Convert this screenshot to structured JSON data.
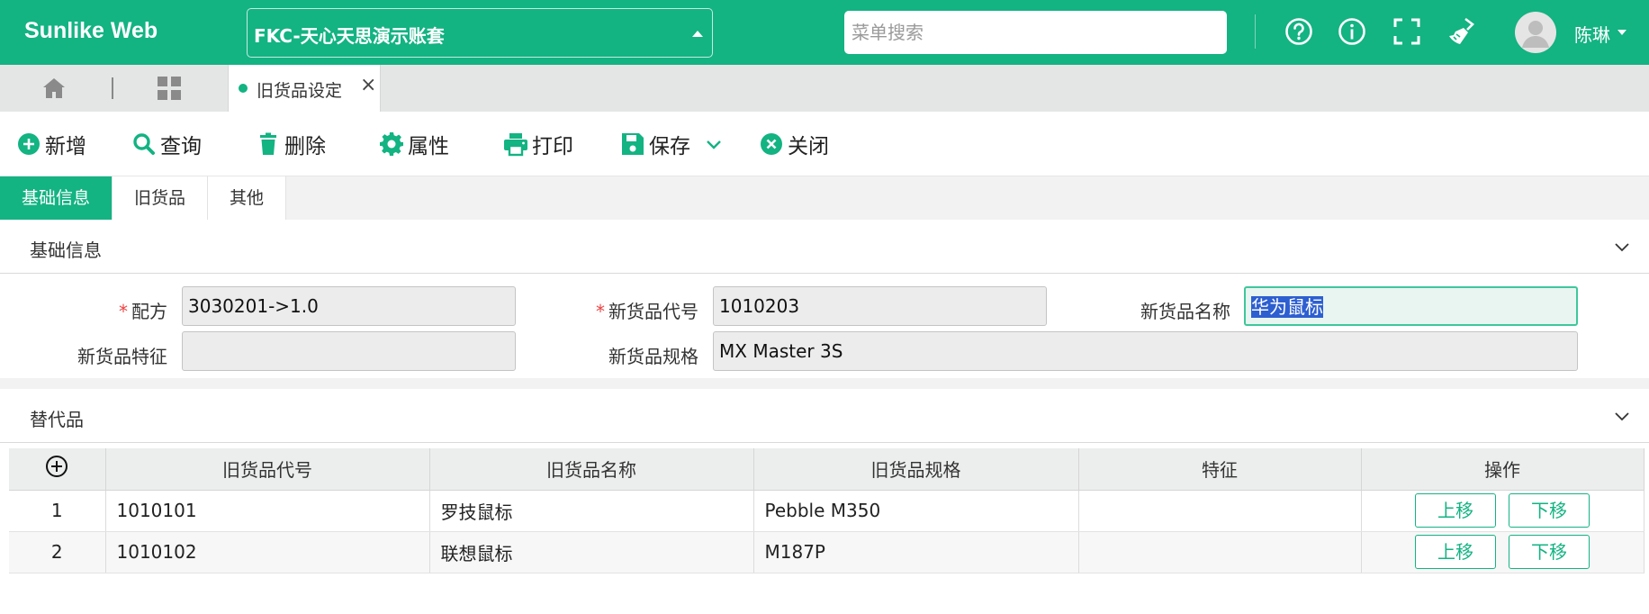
{
  "header": {
    "brand": "Sunlike Web",
    "org_name": "FKC-天心天思演示账套",
    "search_placeholder": "菜单搜索",
    "user_name": "陈琳"
  },
  "tabs": {
    "active_doc": "旧货品设定",
    "close_glyph": "×"
  },
  "toolbar": {
    "add": "新增",
    "query": "查询",
    "delete": "删除",
    "properties": "属性",
    "print": "打印",
    "save": "保存",
    "close": "关闭"
  },
  "section_tabs": [
    "基础信息",
    "旧货品",
    "其他"
  ],
  "basic_info": {
    "title": "基础信息",
    "fields": {
      "formula_label": "配方",
      "formula_value": "3030201->1.0",
      "new_code_label": "新货品代号",
      "new_code_value": "1010203",
      "new_name_label": "新货品名称",
      "new_name_value": "华为鼠标",
      "new_feature_label": "新货品特征",
      "new_feature_value": "",
      "new_spec_label": "新货品规格",
      "new_spec_value": "MX Master 3S"
    }
  },
  "substitutes": {
    "title": "替代品",
    "columns": [
      "旧货品代号",
      "旧货品名称",
      "旧货品规格",
      "特征",
      "操作"
    ],
    "rows": [
      {
        "no": "1",
        "code": "1010101",
        "name": "罗技鼠标",
        "spec": "Pebble M350",
        "feature": "",
        "up": "上移",
        "down": "下移"
      },
      {
        "no": "2",
        "code": "1010102",
        "name": "联想鼠标",
        "spec": "M187P",
        "feature": "",
        "up": "上移",
        "down": "下移"
      }
    ]
  },
  "colors": {
    "brand": "#13b382",
    "required": "#e44444",
    "selection": "#2e5fd1"
  },
  "icons": [
    "help-icon",
    "info-icon",
    "fullscreen-icon",
    "clean-cache-icon",
    "home-icon",
    "grid-icon",
    "add-icon",
    "search-icon",
    "trash-icon",
    "gear-icon",
    "printer-icon",
    "save-icon",
    "close-circle-icon",
    "chevron-down-icon",
    "add-row-icon"
  ]
}
